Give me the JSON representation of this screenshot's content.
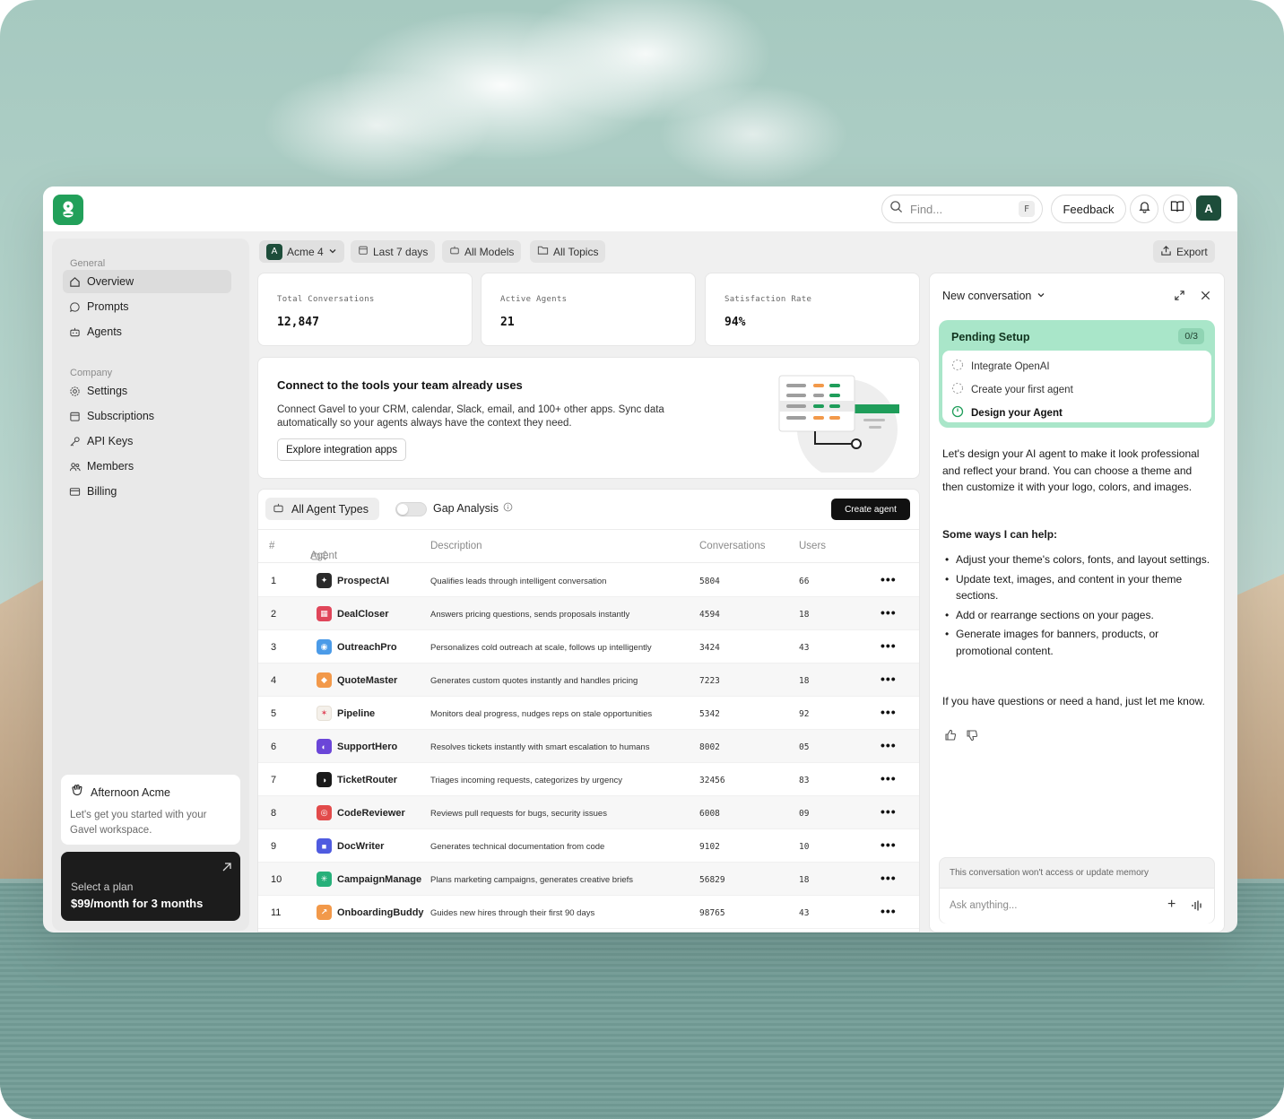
{
  "topbar": {
    "search_placeholder": "Find...",
    "search_shortcut": "F",
    "feedback_label": "Feedback",
    "avatar_initial": "A"
  },
  "sidebar": {
    "general_label": "General",
    "company_label": "Company",
    "general_items": [
      {
        "label": "Overview",
        "icon": "home-icon"
      },
      {
        "label": "Prompts",
        "icon": "chat-bubble-icon"
      },
      {
        "label": "Agents",
        "icon": "robot-icon"
      }
    ],
    "company_items": [
      {
        "label": "Settings",
        "icon": "gear-icon"
      },
      {
        "label": "Subscriptions",
        "icon": "calendar-icon"
      },
      {
        "label": "API Keys",
        "icon": "key-icon"
      },
      {
        "label": "Members",
        "icon": "users-icon"
      },
      {
        "label": "Billing",
        "icon": "card-icon"
      }
    ],
    "welcome_title": "Afternoon Acme",
    "welcome_text": "Let's get you started with your Gavel workspace.",
    "plan_title": "Select a plan",
    "plan_price": "$99/month for 3 months"
  },
  "filters": {
    "workspace": "Acme 4",
    "workspace_initial": "A",
    "range": "Last 7 days",
    "models": "All Models",
    "topics": "All Topics",
    "export": "Export"
  },
  "stats": [
    {
      "label": "Total Conversations",
      "value": "12,847"
    },
    {
      "label": "Active Agents",
      "value": "21"
    },
    {
      "label": "Satisfaction Rate",
      "value": "94%"
    }
  ],
  "integration": {
    "title": "Connect to the tools your team already uses",
    "description": "Connect Gavel to your CRM, calendar, Slack, email, and 100+ other apps. Sync data automatically so your agents always have the context they need.",
    "button": "Explore integration apps"
  },
  "table": {
    "type_filter": "All Agent Types",
    "gap_label": "Gap Analysis",
    "create_label": "Create agent",
    "headers": {
      "num": "#",
      "agent": "Agent",
      "description": "Description",
      "conversations": "Conversations",
      "users": "Users"
    },
    "rows": [
      {
        "num": "1",
        "name": "ProspectAI",
        "desc": "Qualifies leads through intelligent conversation",
        "conv": "5804",
        "users": "66",
        "color": "#2b2b2b",
        "glyph": "✦"
      },
      {
        "num": "2",
        "name": "DealCloser",
        "desc": "Answers pricing questions, sends proposals instantly",
        "conv": "4594",
        "users": "18",
        "color": "#e0465a",
        "glyph": "▦"
      },
      {
        "num": "3",
        "name": "OutreachPro",
        "desc": "Personalizes cold outreach at scale, follows up intelligently",
        "conv": "3424",
        "users": "43",
        "color": "#4b9be8",
        "glyph": "◉"
      },
      {
        "num": "4",
        "name": "QuoteMaster",
        "desc": "Generates custom quotes instantly and handles pricing",
        "conv": "7223",
        "users": "18",
        "color": "#f2994a",
        "glyph": "◆"
      },
      {
        "num": "5",
        "name": "Pipeline",
        "desc": "Monitors deal progress, nudges reps on stale opportunities",
        "conv": "5342",
        "users": "92",
        "color": "#f4f0ea",
        "glyph": "✶"
      },
      {
        "num": "6",
        "name": "SupportHero",
        "desc": "Resolves tickets instantly with smart escalation to humans",
        "conv": "8002",
        "users": "05",
        "color": "#6b46d8",
        "glyph": "◐"
      },
      {
        "num": "7",
        "name": "TicketRouter",
        "desc": "Triages incoming requests, categorizes by urgency",
        "conv": "32456",
        "users": "83",
        "color": "#1a1a1a",
        "glyph": "◑"
      },
      {
        "num": "8",
        "name": "CodeReviewer",
        "desc": "Reviews pull requests for bugs, security issues",
        "conv": "6008",
        "users": "09",
        "color": "#e24b4b",
        "glyph": "◎"
      },
      {
        "num": "9",
        "name": "DocWriter",
        "desc": "Generates technical documentation from code",
        "conv": "9102",
        "users": "10",
        "color": "#4f5be0",
        "glyph": "■"
      },
      {
        "num": "10",
        "name": "CampaignManage",
        "desc": "Plans marketing campaigns, generates creative briefs",
        "conv": "56829",
        "users": "18",
        "color": "#27b07a",
        "glyph": "✳"
      },
      {
        "num": "11",
        "name": "OnboardingBuddy",
        "desc": "Guides new hires through their first 90 days",
        "conv": "98765",
        "users": "43",
        "color": "#f2994a",
        "glyph": "↗"
      }
    ]
  },
  "chat": {
    "title": "New conversation",
    "setup_title": "Pending Setup",
    "setup_count": "0/3",
    "setup_items": [
      "Integrate OpenAI",
      "Create your first agent",
      "Design your Agent"
    ],
    "intro": "Let's design your AI agent to make it look professional and reflect your brand. You can choose a theme and then customize it with your logo, colors, and images.",
    "help_heading": "Some ways I can help:",
    "help_items": [
      "Adjust your theme's colors, fonts, and layout settings.",
      "Update text, images, and content in your theme sections.",
      "Add or rearrange sections on your pages.",
      "Generate images for banners, products, or promotional content."
    ],
    "closing": "If you have questions or need a hand, just let me know.",
    "memory_note": "This conversation won't access or update memory",
    "input_placeholder": "Ask anything..."
  }
}
